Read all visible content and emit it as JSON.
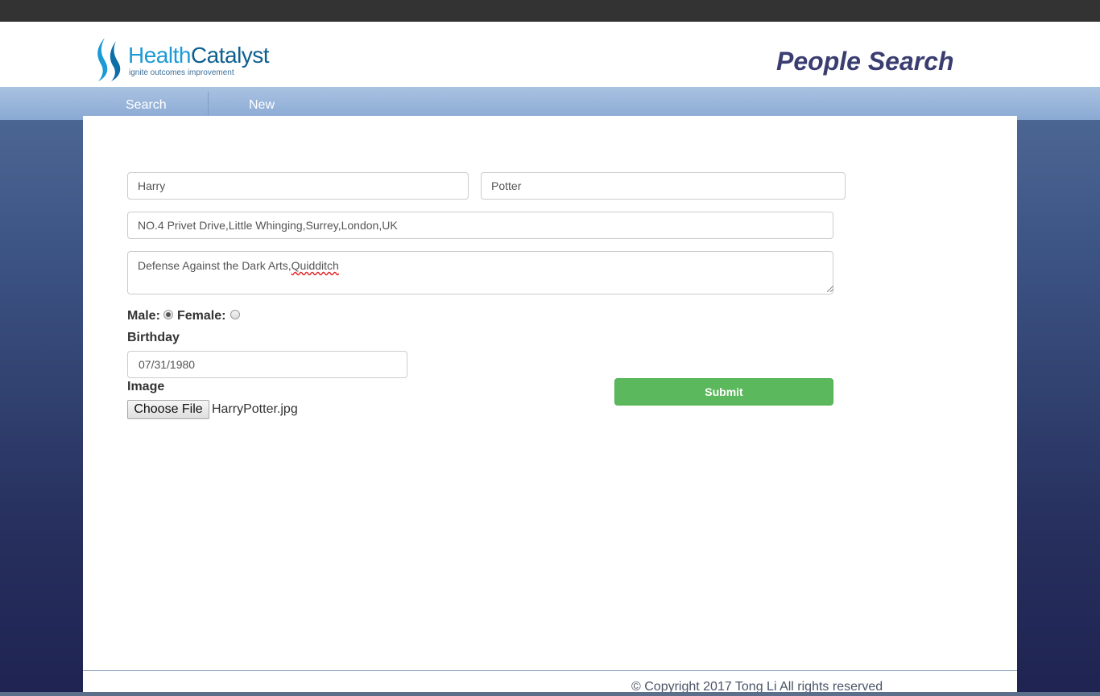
{
  "header": {
    "logo_health": "Health",
    "logo_catalyst": "Catalyst",
    "logo_tagline": "ignite outcomes improvement",
    "page_title": "People Search"
  },
  "nav": {
    "items": [
      {
        "label": "Search"
      },
      {
        "label": "New"
      }
    ]
  },
  "form": {
    "first_name": "Harry",
    "last_name": "Potter",
    "address": "NO.4 Privet Drive,Little Whinging,Surrey,London,UK",
    "interests_prefix": "Defense Against the Dark Arts,",
    "interests_misspelled": "Quidditch",
    "male_label": "Male:",
    "female_label": "Female:",
    "gender_selected": "Male",
    "birthday_label": "Birthday",
    "birthday": "07/31/1980",
    "image_label": "Image",
    "choose_file_label": "Choose File",
    "file_name": "HarryPotter.jpg",
    "submit_label": "Submit"
  },
  "footer": {
    "copyright": "© Copyright 2017 Tong Li All rights reserved"
  },
  "colors": {
    "title": "#3a3d70",
    "submit": "#5cb85c",
    "topbar": "#333333",
    "nav": "#9ab5dc"
  }
}
